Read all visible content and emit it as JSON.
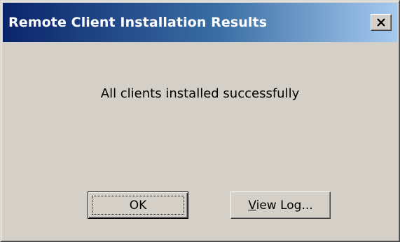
{
  "window": {
    "title": "Remote Client Installation Results",
    "close_icon": "close-icon"
  },
  "message": "All clients installed successfully",
  "buttons": {
    "ok_label": "OK",
    "view_log_mnemonic": "V",
    "view_log_rest": "iew Log..."
  },
  "colors": {
    "titlebar_start": "#0a246a",
    "titlebar_end": "#a6caf0",
    "face": "#d4d0c8"
  }
}
